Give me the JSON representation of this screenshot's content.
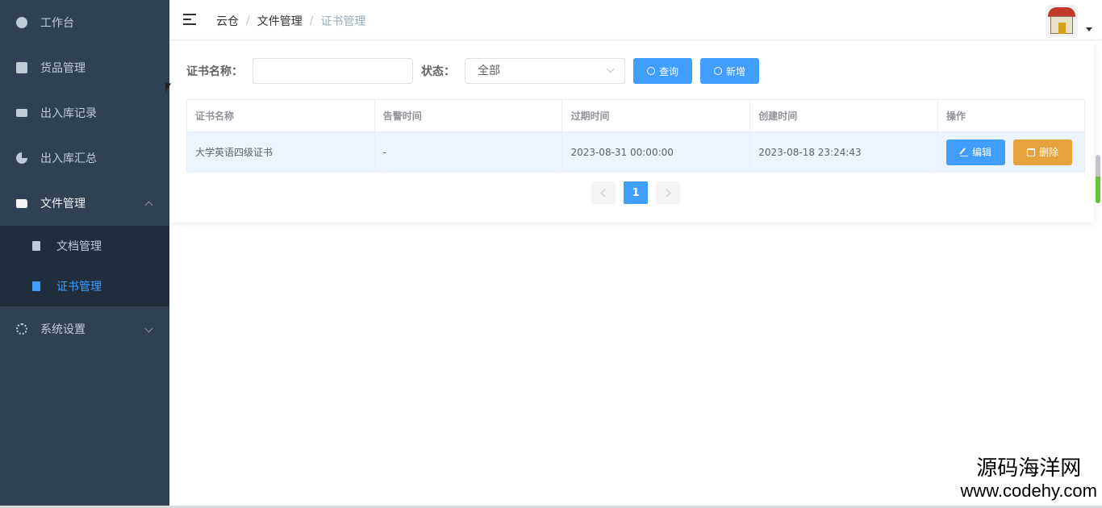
{
  "sidebar": {
    "items": [
      {
        "label": "工作台",
        "icon": "dashboard-icon"
      },
      {
        "label": "货品管理",
        "icon": "box-icon"
      },
      {
        "label": "出入库记录",
        "icon": "truck-icon"
      },
      {
        "label": "出入库汇总",
        "icon": "pie-chart-icon"
      },
      {
        "label": "文件管理",
        "icon": "folder-icon",
        "expanded": true
      },
      {
        "label": "系统设置",
        "icon": "gear-icon"
      }
    ],
    "submenu": [
      {
        "label": "文档管理",
        "icon": "document-icon"
      },
      {
        "label": "证书管理",
        "icon": "document-icon",
        "active": true
      }
    ]
  },
  "breadcrumb": {
    "items": [
      "云仓",
      "文件管理",
      "证书管理"
    ],
    "separator": "/"
  },
  "filter": {
    "name_label": "证书名称：",
    "name_value": "",
    "status_label": "状态：",
    "status_value": "全部",
    "search_label": "查询",
    "add_label": "新增"
  },
  "table": {
    "headers": [
      "证书名称",
      "告警时间",
      "过期时间",
      "创建时间",
      "操作"
    ],
    "rows": [
      {
        "name": "大学英语四级证书",
        "alarm_time": "-",
        "expire_time": "2023-08-31 00:00:00",
        "create_time": "2023-08-18 23:24:43",
        "edit_label": "编辑",
        "delete_label": "删除"
      }
    ]
  },
  "pagination": {
    "current_page": "1"
  },
  "watermark": {
    "cn": "源码海洋网",
    "url": "www.codehy.com"
  },
  "colors": {
    "sidebar_bg": "#304156",
    "primary": "#409eff",
    "warning": "#e6a23c"
  }
}
